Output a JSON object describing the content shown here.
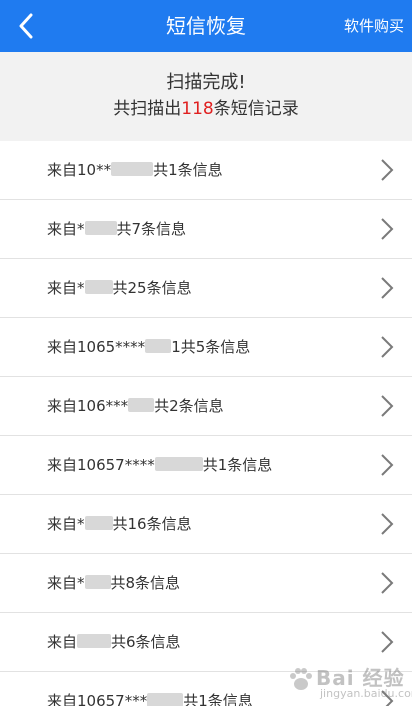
{
  "header": {
    "title": "短信恢复",
    "buy_label": "软件购买",
    "accent_color": "#1f7bf0"
  },
  "summary": {
    "title": "扫描完成!",
    "prefix": "共扫描出",
    "count": "118",
    "suffix": "条短信记录",
    "count_color": "#e02020"
  },
  "records": [
    {
      "prefix": "来自10**",
      "suffix": "共1条信息"
    },
    {
      "prefix": "来自*",
      "suffix": "共7条信息"
    },
    {
      "prefix": "来自*",
      "suffix": "共25条信息"
    },
    {
      "prefix": "来自1065****",
      "suffix": "1共5条信息"
    },
    {
      "prefix": "来自106***",
      "suffix": "共2条信息"
    },
    {
      "prefix": "来自10657****",
      "suffix": "共1条信息"
    },
    {
      "prefix": "来自*",
      "suffix": "共16条信息"
    },
    {
      "prefix": "来自*",
      "suffix": "共8条信息"
    },
    {
      "prefix": "来自",
      "suffix": "共6条信息"
    },
    {
      "prefix": "来自10657***",
      "suffix": "共1条信息"
    }
  ],
  "watermark": {
    "text": "Bai 经验",
    "sub": "jingyan.baidu.com"
  }
}
